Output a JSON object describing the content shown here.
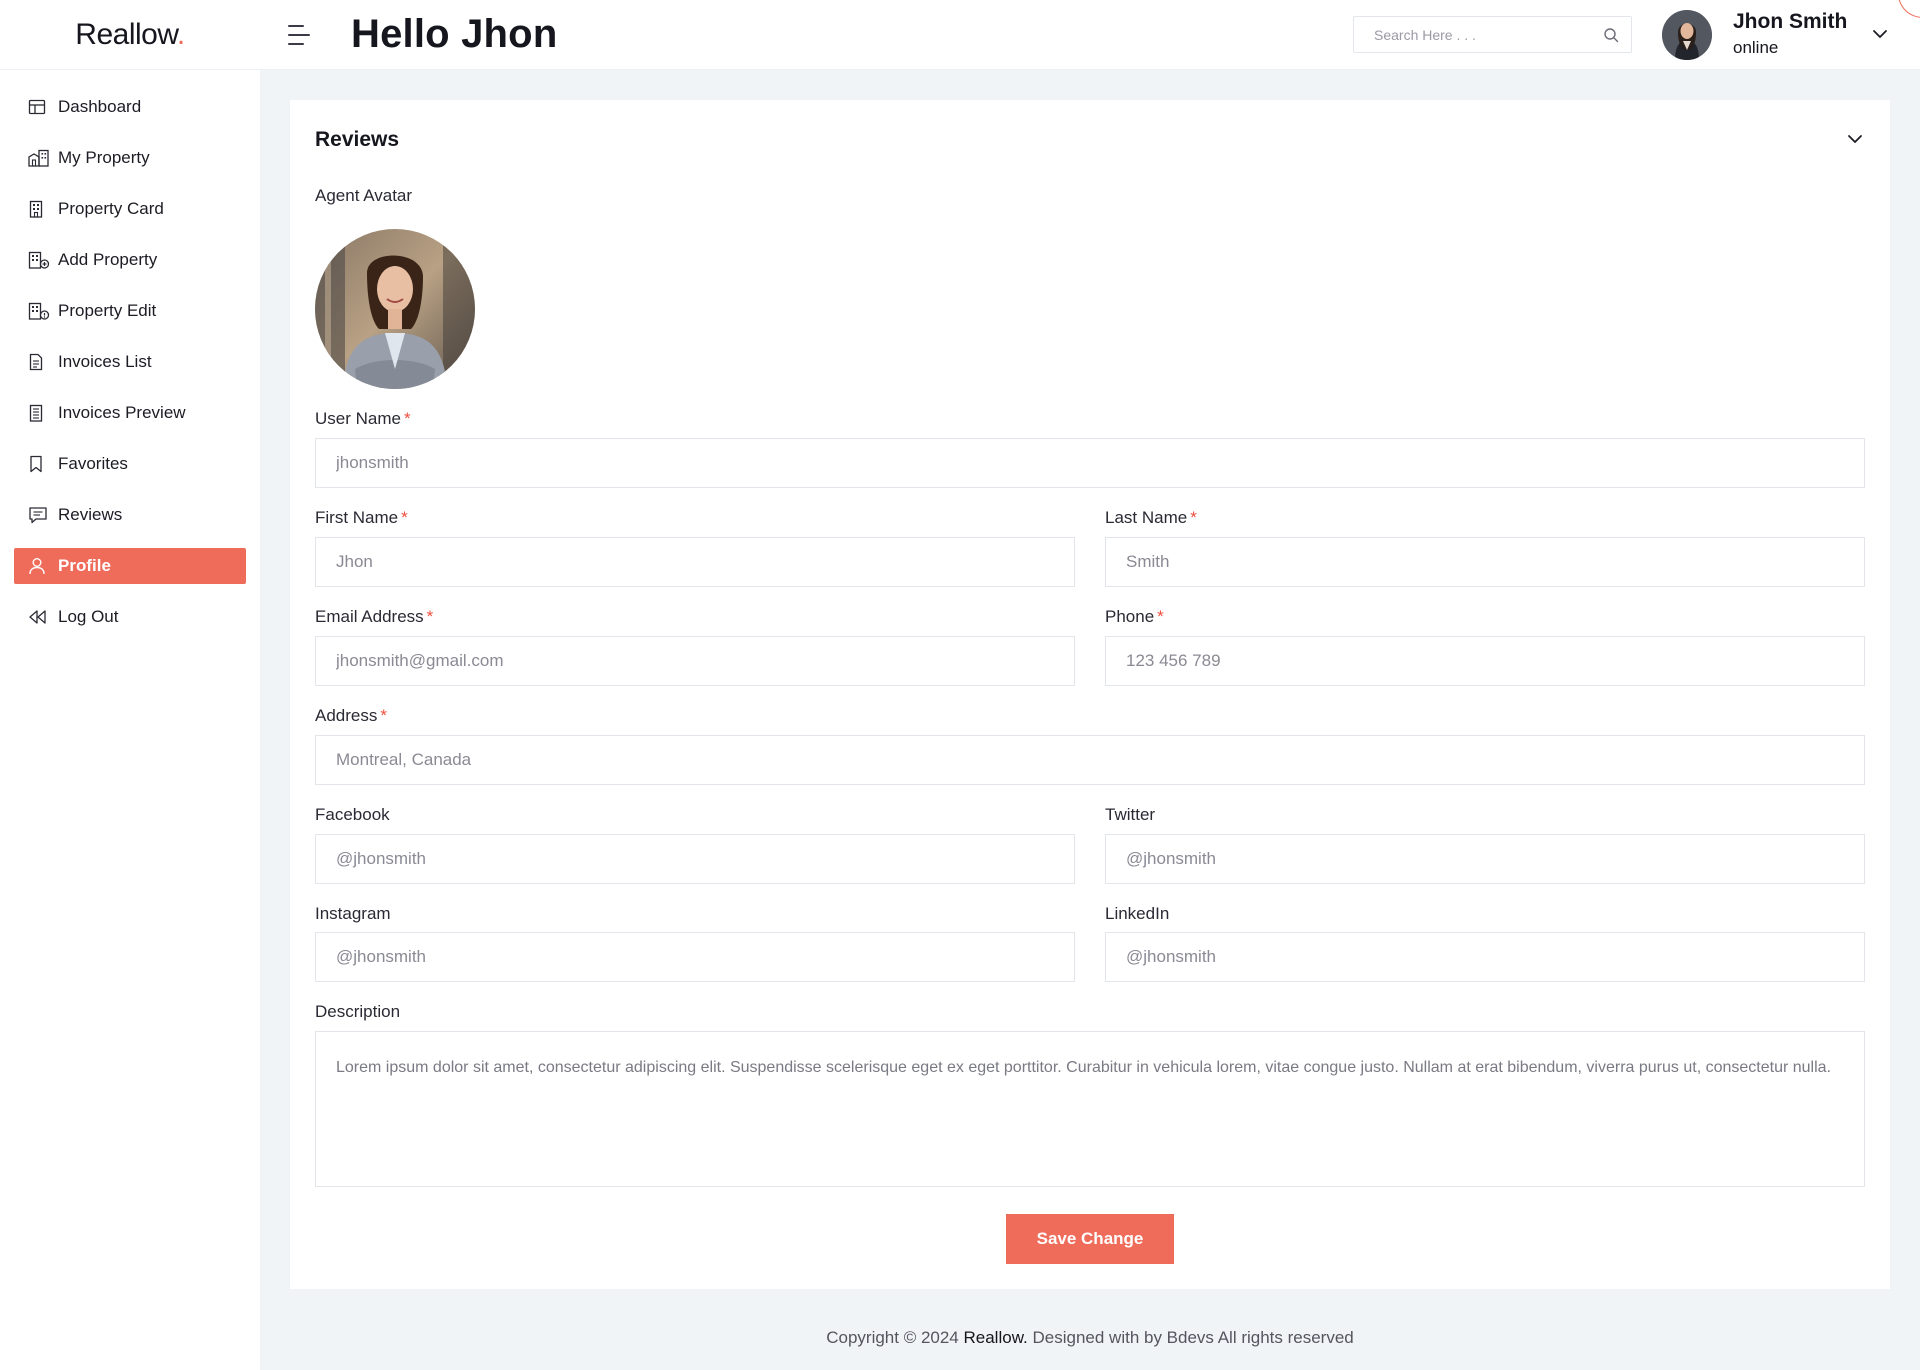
{
  "brand": {
    "name": "Reallow",
    "dot": "."
  },
  "header": {
    "greeting": "Hello Jhon",
    "search_placeholder": "Search Here . . .",
    "user": {
      "name": "Jhon Smith",
      "status": "online"
    }
  },
  "sidebar": {
    "items": [
      {
        "label": "Dashboard",
        "icon": "dashboard-icon"
      },
      {
        "label": "My Property",
        "icon": "buildings-icon"
      },
      {
        "label": "Property Card",
        "icon": "building-icon"
      },
      {
        "label": "Add Property",
        "icon": "building-add-icon"
      },
      {
        "label": "Property Edit",
        "icon": "building-edit-icon"
      },
      {
        "label": "Invoices List",
        "icon": "document-icon"
      },
      {
        "label": "Invoices Preview",
        "icon": "receipt-icon"
      },
      {
        "label": "Favorites",
        "icon": "bookmark-icon"
      },
      {
        "label": "Reviews",
        "icon": "message-icon"
      },
      {
        "label": "Profile",
        "icon": "user-icon",
        "active": true
      },
      {
        "label": "Log Out",
        "icon": "logout-icon"
      }
    ]
  },
  "form": {
    "title": "Reviews",
    "avatar_label": "Agent Avatar",
    "required_mark": "*",
    "username": {
      "label": "User Name",
      "placeholder": "jhonsmith"
    },
    "first_name": {
      "label": "First Name",
      "placeholder": "Jhon"
    },
    "last_name": {
      "label": "Last Name",
      "placeholder": "Smith"
    },
    "email": {
      "label": "Email Address",
      "placeholder": "jhonsmith@gmail.com"
    },
    "phone": {
      "label": "Phone",
      "placeholder": "123 456 789"
    },
    "address": {
      "label": "Address",
      "placeholder": "Montreal, Canada"
    },
    "facebook": {
      "label": "Facebook",
      "placeholder": "@jhonsmith"
    },
    "twitter": {
      "label": "Twitter",
      "placeholder": "@jhonsmith"
    },
    "instagram": {
      "label": "Instagram",
      "placeholder": "@jhonsmith"
    },
    "linkedin": {
      "label": "LinkedIn",
      "placeholder": "@jhonsmith"
    },
    "description": {
      "label": "Description",
      "value": "Lorem ipsum dolor sit amet, consectetur adipiscing elit. Suspendisse scelerisque eget ex eget porttitor. Curabitur in vehicula lorem, vitae congue justo. Nullam at erat bibendum, viverra purus ut, consectetur nulla."
    },
    "save_label": "Save Change"
  },
  "footer": {
    "prefix": "Copyright © 2024 ",
    "brand": "Reallow.",
    "suffix": " Designed with by Bdevs All rights reserved"
  },
  "colors": {
    "accent": "#ef6b5a",
    "required": "#ef4d3c",
    "background": "#f1f4f7"
  }
}
